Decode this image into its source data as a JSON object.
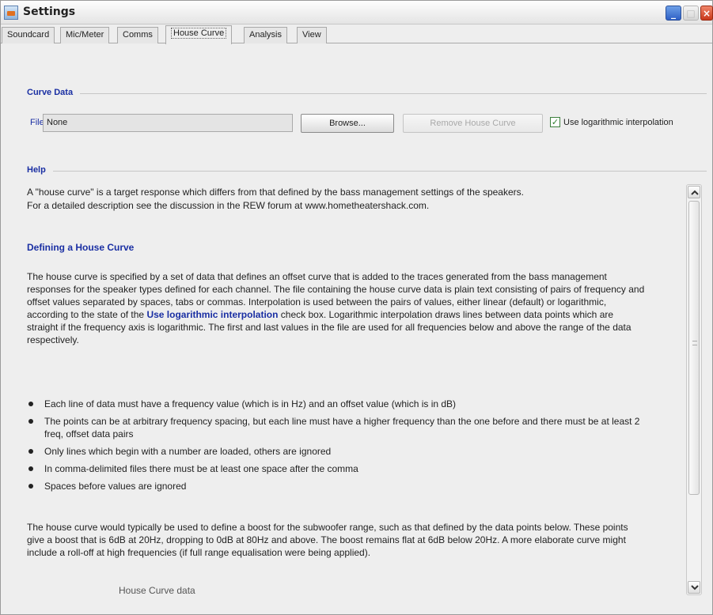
{
  "window": {
    "title": "Settings",
    "app_icon": "java-cup-icon"
  },
  "tabs": [
    {
      "label": "Soundcard"
    },
    {
      "label": "Mic/Meter"
    },
    {
      "label": "Comms"
    },
    {
      "label": "House Curve",
      "active": true
    },
    {
      "label": "Analysis"
    },
    {
      "label": "View"
    }
  ],
  "curve_data": {
    "heading": "Curve Data",
    "file_label": "File:",
    "file_value": "None",
    "browse_label": "Browse...",
    "remove_label": "Remove House Curve",
    "log_interp_label": "Use logarithmic interpolation",
    "log_interp_checked": true
  },
  "help": {
    "heading": "Help",
    "intro_1": "A \"house curve\" is a target response which differs from that defined by the bass management settings of the speakers.",
    "intro_2": "For a detailed description see the discussion in the REW forum at www.hometheatershack.com.",
    "defining_title": "Defining a House Curve",
    "para1_a": "The house curve is specified by a set of data that defines an offset curve that is added to the traces generated from the bass management responses for the speaker types defined for each channel. The file containing the house curve data is plain text consisting of pairs of frequency and offset values separated by spaces, tabs or commas. Interpolation is used between the pairs of values, either linear (default) or logarithmic, according to the state of the ",
    "para1_kw": "Use logarithmic interpolation",
    "para1_b": " check box. Logarithmic interpolation draws lines between data points which are straight if the frequency axis is logarithmic. The first and last values in the file are used for all frequencies below and above the range of the data respectively.",
    "bullets": [
      "Each line of data must have a frequency value (which is in Hz) and an offset value (which is in dB)",
      "The points can be at arbitrary frequency spacing, but each line must have a higher frequency than the one before and there must be at least 2 freq, offset data pairs",
      "Only lines which begin with a number are loaded, others are ignored",
      "In comma-delimited files there must be at least one space after the comma",
      "Spaces before values are ignored"
    ],
    "para2": "The house curve would typically be used to define a boost for the subwoofer range, such as that defined by the data points below. These points give a boost that is 6dB at 20Hz, dropping to 0dB at 80Hz and above. The boost remains flat at 6dB below 20Hz. A more elaborate curve might include a roll-off at high frequencies (if full range equalisation were being applied).",
    "cut_line": "House Curve data"
  },
  "colors": {
    "accent_blue": "#1a2fa3",
    "check_green": "#2f7f2f"
  }
}
